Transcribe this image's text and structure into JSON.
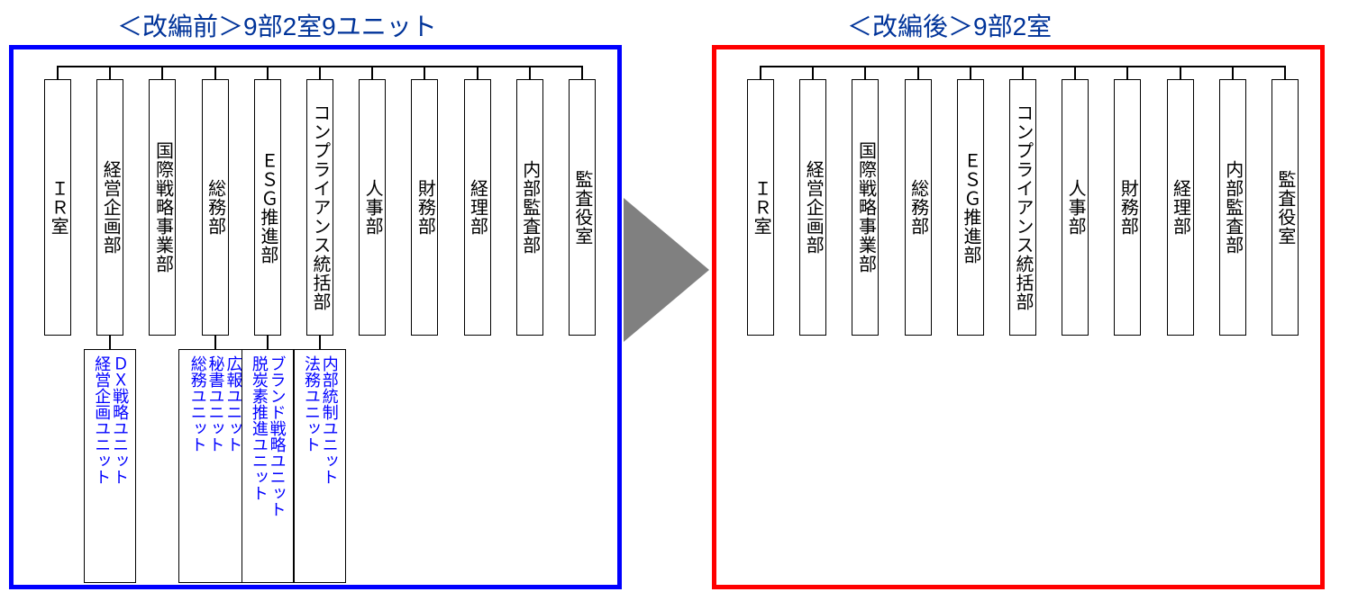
{
  "titles": {
    "before": "＜改編前＞9部2室9ユニット",
    "after": "＜改編後＞9部2室"
  },
  "departments": [
    "ＩＲ室",
    "経営企画部",
    "国際戦略事業部",
    "総務部",
    "ＥＳＧ推進部",
    "コンプライアンス統括部",
    "人事部",
    "財務部",
    "経理部",
    "内部監査部",
    "監査役室"
  ],
  "unitGroups": [
    {
      "parentIndex": 1,
      "units": [
        "ＤＸ戦略ユニット",
        "経営企画ユニット"
      ]
    },
    {
      "parentIndex": 3,
      "units": [
        "広報ユニット",
        "秘書ユニット",
        "総務ユニット"
      ]
    },
    {
      "parentIndex": 4,
      "units": [
        "ブランド戦略ユニット",
        "脱炭素推進ユニット"
      ]
    },
    {
      "parentIndex": 5,
      "units": [
        "内部統制ユニット",
        "法務ユニット"
      ]
    }
  ]
}
